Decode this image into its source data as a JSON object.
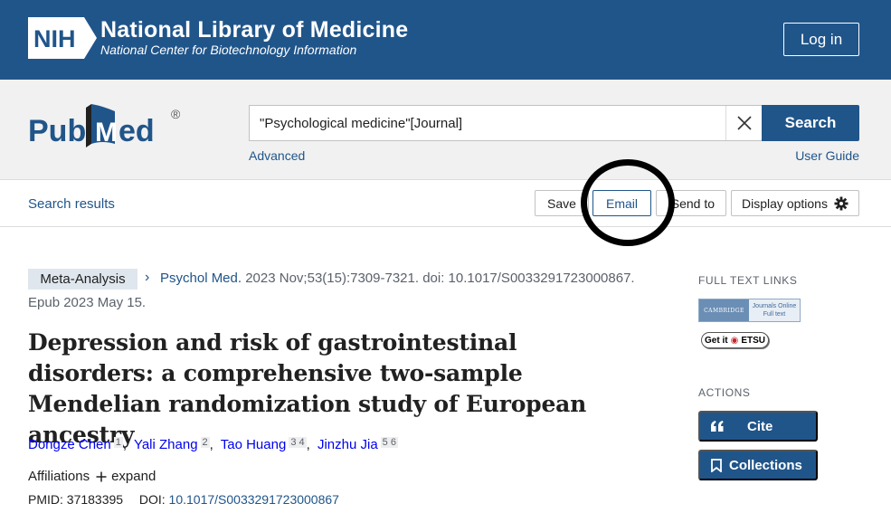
{
  "header": {
    "logo_text": "NIH",
    "title": "National Library of Medicine",
    "subtitle": "National Center for Biotechnology Information",
    "login_label": "Log in"
  },
  "search": {
    "brand": "PubMed",
    "query": "\"Psychological medicine\"[Journal]",
    "search_label": "Search",
    "advanced_label": "Advanced",
    "user_guide_label": "User Guide"
  },
  "toolbar": {
    "back_label": "Search results",
    "save_label": "Save",
    "email_label": "Email",
    "send_to_label": "Send to",
    "display_options_label": "Display options"
  },
  "article": {
    "publication_type": "Meta-Analysis",
    "journal": "Psychol Med.",
    "citation": "2023 Nov;53(15):7309-7321. doi: 10.1017/S0033291723000867.",
    "epub": "Epub 2023 May 15.",
    "title": "Depression and risk of gastrointestinal disorders: a comprehensive two-sample Mendelian randomization study of European ancestry",
    "authors": [
      {
        "name": "Dongze Chen",
        "affils": "1"
      },
      {
        "name": "Yali Zhang",
        "affils": "2"
      },
      {
        "name": "Tao Huang",
        "affils": "3 4"
      },
      {
        "name": "Jinzhu Jia",
        "affils": "5 6"
      }
    ],
    "affiliations_label": "Affiliations",
    "expand_label": "expand",
    "pmid_label": "PMID:",
    "pmid": "37183395",
    "doi_label": "DOI:",
    "doi": "10.1017/S0033291723000867"
  },
  "sidebar": {
    "full_text_heading": "FULL TEXT LINKS",
    "cambridge_left": "CAMBRIDGE",
    "cambridge_right1": "Journals Online",
    "cambridge_right2": "Full text",
    "getit_label_a": "Get it",
    "getit_label_b": "ETSU",
    "actions_heading": "ACTIONS",
    "cite_label": "Cite",
    "collections_label": "Collections"
  },
  "colors": {
    "primary": "#20558a",
    "header_bg": "#20558a",
    "search_band_bg": "#f1f1f1",
    "badge_bg": "#dfe6ee"
  }
}
